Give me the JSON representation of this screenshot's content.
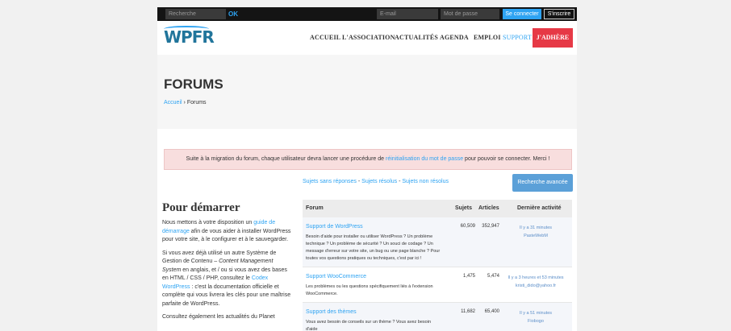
{
  "topbar": {
    "search_placeholder": "Recherche",
    "ok_label": "OK",
    "email_placeholder": "E-mail",
    "password_placeholder": "Mot de passe",
    "connect_label": "Se connecter",
    "signup_label": "S'inscrire"
  },
  "header": {
    "logo": "WPFR",
    "nav": [
      "ACCUEIL",
      "L'ASSOCIATION",
      "ACTUALITÉS",
      "AGENDA",
      "EMPLOI",
      "SUPPORT"
    ],
    "adhere_label": "J'ADHÈRE"
  },
  "hero": {
    "title": "FORUMS",
    "breadcrumb_home": "Accueil",
    "breadcrumb_sep": " › ",
    "breadcrumb_current": "Forums"
  },
  "notice": {
    "before": "Suite à la migration du forum, chaque utilisateur devra lancer une procédure de ",
    "link": "réinitialisation du mot de passe",
    "after": " pour pouvoir se connecter. Merci !"
  },
  "filters": {
    "unanswered": "Sujets sans réponses",
    "resolved": "Sujets résolus",
    "unresolved": "Sujets non résolus",
    "sep": " - "
  },
  "advanced_search_label": "Recherche avancée",
  "left": {
    "heading": "Pour démarrer",
    "p1_before": "Nous mettons à votre disposition un ",
    "p1_link": "guide de démarrage",
    "p1_after": " afin de vous aider à installer WordPress pour votre site, à le configurer et à le sauvegarder.",
    "p2_before": "Si vous avez déjà utilisé un autre Système de Gestion de Contenu – ",
    "p2_em": "Content Management System",
    "p2_mid": " en anglais, et / ou si vous avez des bases en HTML / CSS / PHP, consultez le ",
    "p2_link": "Codex WordPress",
    "p2_after": " : c'est la documentation officielle et complète qui vous livrera les clés pour une maîtrise parfaite de WordPress.",
    "p3": "Consultez également les actualités du Planet"
  },
  "table": {
    "headers": {
      "forum": "Forum",
      "topics": "Sujets",
      "posts": "Articles",
      "activity": "Dernière activité"
    },
    "rows": [
      {
        "title": "Support de WordPress",
        "description": "Besoin d'aide pour installer ou utiliser WordPress ? Un problème technique ? Un problème de sécurité ? Un souci de codage ? Un message d'erreur sur votre site, un bug ou une page blanche ? Pour toutes vos questions pratiques ou techniques, c'est par ici !",
        "topics": "60,509",
        "posts": "352,947",
        "activity_time": "Il y a 31 minutes",
        "activity_user": "PasteWebM"
      },
      {
        "title": "Support WooCommerce",
        "description": "Les problèmes ou les questions spécifiquement liés à l'extension WooCommerce.",
        "topics": "1,475",
        "posts": "5,474",
        "activity_time": "Il y a 3 heures et 53 minutes",
        "activity_user": "kristi_dido@yahoo.fr"
      },
      {
        "title": "Support des thèmes",
        "description": "Vous avez besoin de conseils sur un thème ? Vous avez besoin d'aide",
        "topics": "11,682",
        "posts": "65,400",
        "activity_time": "Il y a 51 minutes",
        "activity_user": "Fiobogo"
      }
    ]
  }
}
